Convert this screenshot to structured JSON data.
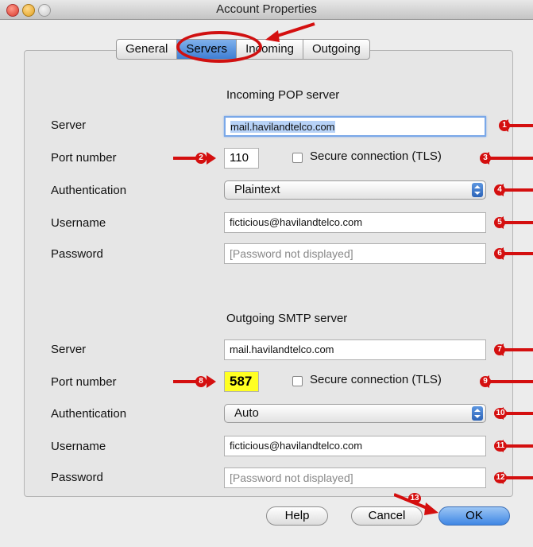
{
  "window": {
    "title": "Account Properties"
  },
  "tabs": [
    "General",
    "Servers",
    "Incoming",
    "Outgoing"
  ],
  "incoming": {
    "heading": "Incoming POP server",
    "server_label": "Server",
    "server_value": "mail.havilandtelco.com",
    "port_label": "Port number",
    "port_value": "110",
    "secure_label": "Secure connection (TLS)",
    "auth_label": "Authentication",
    "auth_value": "Plaintext",
    "username_label": "Username",
    "username_value": "ficticious@havilandtelco.com",
    "password_label": "Password",
    "password_placeholder": "[Password not displayed]"
  },
  "outgoing": {
    "heading": "Outgoing SMTP server",
    "server_label": "Server",
    "server_value": "mail.havilandtelco.com",
    "port_label": "Port number",
    "port_value": "587",
    "secure_label": "Secure connection (TLS)",
    "auth_label": "Authentication",
    "auth_value": "Auto",
    "username_label": "Username",
    "username_value": "ficticious@havilandtelco.com",
    "password_label": "Password",
    "password_placeholder": "[Password not displayed]"
  },
  "buttons": {
    "help": "Help",
    "cancel": "Cancel",
    "ok": "OK"
  },
  "annotations": [
    "1",
    "2",
    "3",
    "4",
    "5",
    "6",
    "7",
    "8",
    "9",
    "10",
    "11",
    "12",
    "13"
  ],
  "colors": {
    "annotation": "#d40f0f",
    "highlight": "#ffff22",
    "accent": "#3f86e4"
  }
}
